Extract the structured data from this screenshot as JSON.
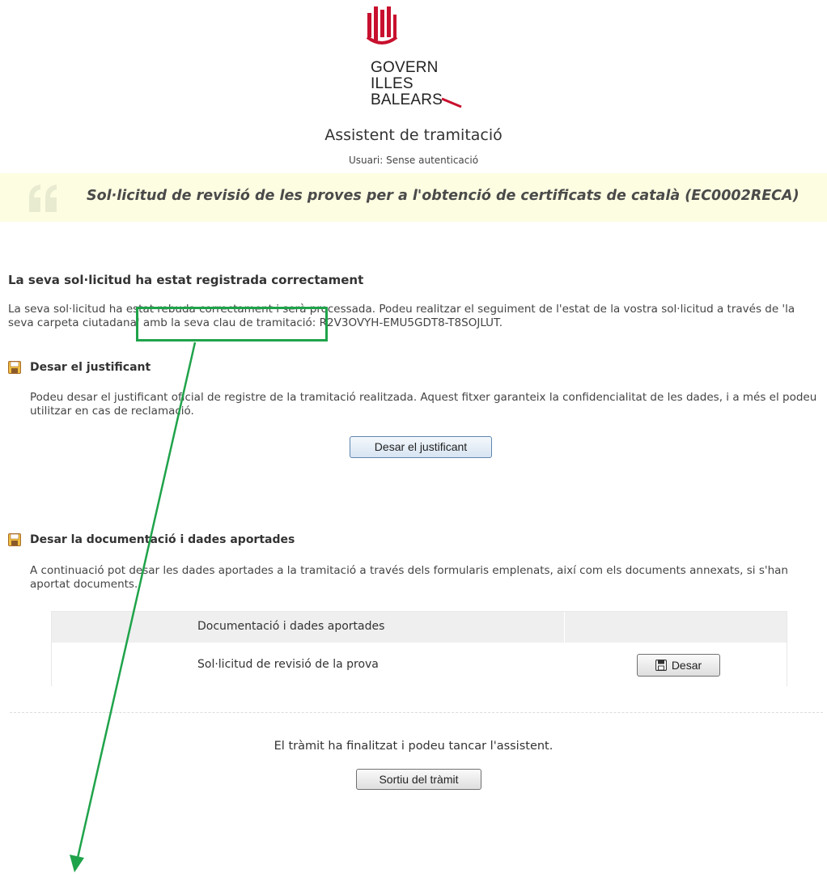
{
  "logo": {
    "lines": [
      "GOVERN",
      "ILLES",
      "BALEARS"
    ]
  },
  "header": {
    "title": "Assistent de tramitació",
    "user_line": "Usuari: Sense autenticació"
  },
  "banner": {
    "text": "Sol·licitud de revisió de les proves per a l'obtenció de certificats de català (EC0002RECA)"
  },
  "confirmation": {
    "heading": "La seva sol·licitud ha estat registrada correctament",
    "text": "La seva sol·licitud ha estat rebuda correctament i serà processada. Podeu realitzar el seguiment de l'estat de la vostra sol·licitud a través de 'la seva carpeta ciutadana' amb la seva clau de tramitació: R2V3OVYH-EMU5GDT8-T8SOJLUT."
  },
  "receipt": {
    "title": "Desar el justificant",
    "text": "Podeu desar el justificant oficial de registre de la tramitació realitzada. Aquest fitxer garanteix la confidencialitat de les dades, i a més el podeu utilitzar en cas de reclamació.",
    "button": "Desar el justificant"
  },
  "documents": {
    "title": "Desar la documentació i dades aportades",
    "text": "A continuació pot desar les dades aportades a la tramitació a través dels formularis emplenats, així com els documents annexats, si s'han aportat documents.",
    "table": {
      "header": "Documentació i dades aportades",
      "rows": [
        {
          "name": "Sol·licitud de revisió de la prova",
          "action": "Desar"
        }
      ]
    }
  },
  "footer": {
    "text": "El tràmit ha finalitzat i podeu tancar l'assistent.",
    "exit_button": "Sortiu del tràmit"
  },
  "colors": {
    "annotation": "#1fa34a",
    "banner_bg": "#fdfde2",
    "logo_red": "#c8102e"
  },
  "icons": {
    "section": "floppy-disk-icon",
    "banner": "quote-icon"
  }
}
